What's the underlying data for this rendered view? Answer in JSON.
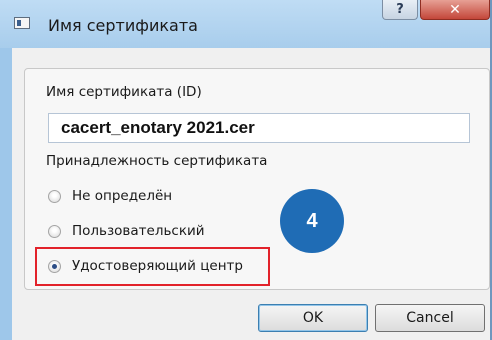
{
  "window": {
    "title": "Имя сертификата",
    "help_label": "?",
    "close_label": "✕"
  },
  "form": {
    "id_label": "Имя сертификата (ID)",
    "id_value": "cacert_enotary 2021.cer",
    "belonging_label": "Принадлежность сертификата",
    "options": [
      {
        "label": "Не определён",
        "selected": false
      },
      {
        "label": "Пользовательский",
        "selected": false
      },
      {
        "label": "Удостоверяющий центр",
        "selected": true
      }
    ]
  },
  "annotation": {
    "step_number": "4",
    "highlight_color": "#e2222a",
    "badge_color": "#1f6cb5"
  },
  "buttons": {
    "ok_label": "OK",
    "cancel_label": "Cancel"
  }
}
